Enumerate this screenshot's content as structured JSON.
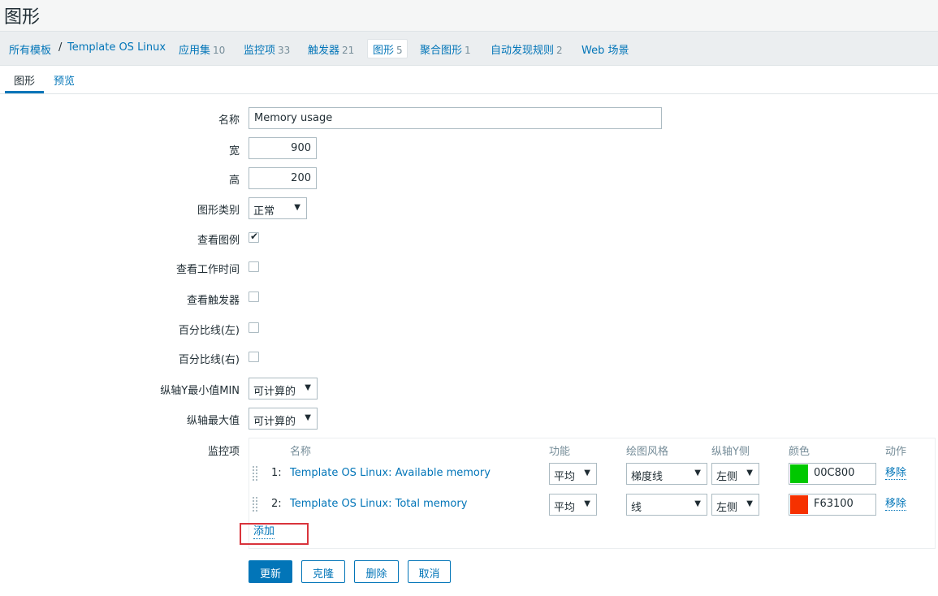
{
  "page_title": "图形",
  "breadcrumb": [
    {
      "label": "所有模板",
      "count": ""
    },
    {
      "label": "Template OS Linux",
      "count": ""
    },
    {
      "label": "应用集",
      "count": "10"
    },
    {
      "label": "监控项",
      "count": "33"
    },
    {
      "label": "触发器",
      "count": "21"
    },
    {
      "label": "图形",
      "count": "5"
    },
    {
      "label": "聚合图形",
      "count": "1"
    },
    {
      "label": "自动发现规则",
      "count": "2"
    },
    {
      "label": "Web 场景",
      "count": ""
    }
  ],
  "breadcrumb_separator": "/",
  "tabs": [
    {
      "label": "图形",
      "active": true
    },
    {
      "label": "预览",
      "active": false
    }
  ],
  "form": {
    "name_label": "名称",
    "name_value": "Memory usage",
    "width_label": "宽",
    "width_value": "900",
    "height_label": "高",
    "height_value": "200",
    "graph_type_label": "图形类别",
    "graph_type_value": "正常",
    "show_legend_label": "查看图例",
    "show_legend_checked": true,
    "show_working_time_label": "查看工作时间",
    "show_working_time_checked": false,
    "show_triggers_label": "查看触发器",
    "show_triggers_checked": false,
    "percentile_left_label": "百分比线(左)",
    "percentile_left_checked": false,
    "percentile_right_label": "百分比线(右)",
    "percentile_right_checked": false,
    "ymin_label": "纵轴Y最小值MIN",
    "ymin_value": "可计算的",
    "ymax_label": "纵轴最大值",
    "ymax_value": "可计算的",
    "items_label": "监控项"
  },
  "items_table": {
    "headers": [
      "名称",
      "功能",
      "绘图风格",
      "纵轴Y侧",
      "颜色",
      "动作"
    ],
    "rows": [
      {
        "num": "1:",
        "name": "Template OS Linux: Available memory",
        "function": "平均",
        "style": "梯度线",
        "yaxis": "左侧",
        "color_hex": "00C800",
        "color": "#00C800",
        "action": "移除"
      },
      {
        "num": "2:",
        "name": "Template OS Linux: Total memory",
        "function": "平均",
        "style": "线",
        "yaxis": "左侧",
        "color_hex": "F63100",
        "color": "#F63100",
        "action": "移除"
      }
    ],
    "add_label": "添加"
  },
  "buttons": {
    "update": "更新",
    "clone": "克隆",
    "delete": "删除",
    "cancel": "取消"
  },
  "icons": {
    "dropdown": "chevron-down-icon",
    "drag": "drag-handle-icon",
    "check": "check-icon"
  },
  "colors": {
    "link": "#0275b8",
    "highlight": "#d9343c"
  }
}
